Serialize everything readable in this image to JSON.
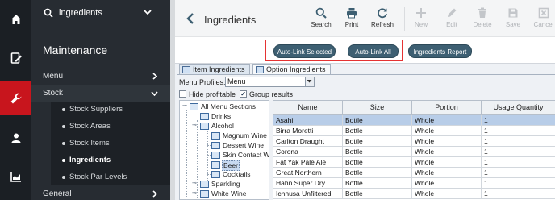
{
  "sidebar": {
    "rail": [
      {
        "icon": "home-icon"
      },
      {
        "icon": "document-edit-icon"
      },
      {
        "icon": "wrench-icon",
        "active": true
      },
      {
        "icon": "person-icon"
      },
      {
        "icon": "chart-icon"
      }
    ],
    "search_value": "ingredients",
    "heading": "Maintenance",
    "menu_label": "Menu",
    "stock_label": "Stock",
    "stock_items": [
      "Stock Suppliers",
      "Stock Areas",
      "Stock Items",
      "Ingredients",
      "Stock Par Levels"
    ],
    "selected_item": "Ingredients",
    "general_label": "General"
  },
  "header": {
    "title": "Ingredients",
    "tools": {
      "search": "Search",
      "print": "Print",
      "refresh": "Refresh",
      "new": "New",
      "edit": "Edit",
      "delete": "Delete",
      "save": "Save",
      "cancel": "Cancel"
    }
  },
  "actions": {
    "auto_link_selected": "Auto-Link Selected",
    "auto_link_all": "Auto-Link All",
    "ingredients_report": "Ingredients Report"
  },
  "tabs": {
    "item_ingredients": "Item Ingredients",
    "option_ingredients": "Option Ingredients"
  },
  "filters": {
    "menu_profiles_label": "Menu Profiles:",
    "menu_profiles_value": "Menu",
    "hide_profitable_label": "Hide profitable",
    "hide_profitable_checked": false,
    "group_results_label": "Group results",
    "group_results_checked": true
  },
  "tree": {
    "root": "All Menu Sections",
    "drinks": "Drinks",
    "alcohol": "Alcohol",
    "magnum": "Magnum Wine",
    "dessert": "Dessert Wine",
    "skin": "Skin Contact W",
    "beer": "Beer",
    "cocktails": "Cocktails",
    "sparkling": "Sparkling",
    "white_wine": "White Wine"
  },
  "table": {
    "columns": {
      "name": "Name",
      "size": "Size",
      "portion": "Portion",
      "usage": "Usage Quantity"
    },
    "rows": [
      {
        "name": "Asahi",
        "size": "Bottle",
        "portion": "Whole",
        "qty": "1"
      },
      {
        "name": "Birra Moretti",
        "size": "Bottle",
        "portion": "Whole",
        "qty": "1"
      },
      {
        "name": "Carlton Draught",
        "size": "Bottle",
        "portion": "Whole",
        "qty": "1"
      },
      {
        "name": "Corona",
        "size": "Bottle",
        "portion": "Whole",
        "qty": "1"
      },
      {
        "name": "Fat Yak Pale Ale",
        "size": "Bottle",
        "portion": "Whole",
        "qty": "1"
      },
      {
        "name": "Great Northern",
        "size": "Bottle",
        "portion": "Whole",
        "qty": "1"
      },
      {
        "name": "Hahn Super Dry",
        "size": "Bottle",
        "portion": "Whole",
        "qty": "1"
      },
      {
        "name": "Ichnusa Unfiltered",
        "size": "Bottle",
        "portion": "Whole",
        "qty": "1"
      }
    ]
  },
  "colors": {
    "rail_bg": "#1b1f24",
    "rail_active": "#c8151d",
    "nav_bg": "#272c32",
    "action_button": "#3d5f72",
    "highlight_box": "#e53333",
    "selected_row": "#b8cde8"
  }
}
